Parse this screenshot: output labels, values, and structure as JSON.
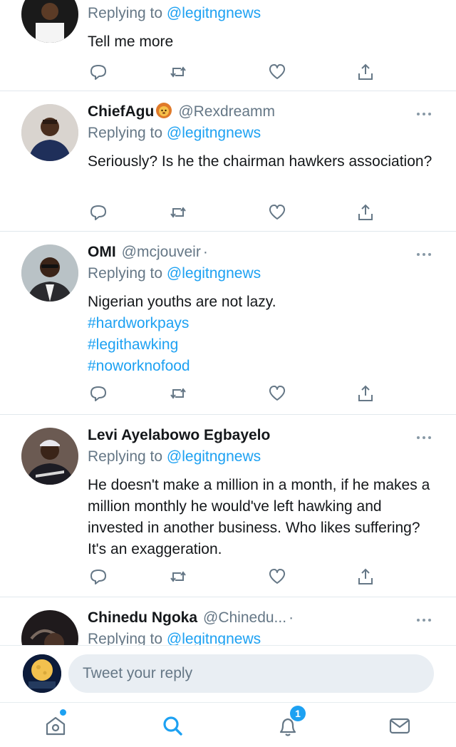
{
  "colors": {
    "accent": "#1da1f2",
    "muted": "#657786",
    "text": "#14171a",
    "divider": "#e1e8ed",
    "input_bg": "#e9eef3"
  },
  "tweets": [
    {
      "reply_prefix": "Replying to",
      "reply_handle": "@legitngnews",
      "text": "Tell me more"
    },
    {
      "name": "ChiefAgu",
      "emoji": "lion-face-icon",
      "handle": "@Rexdreamm",
      "reply_prefix": "Replying to",
      "reply_handle": "@legitngnews",
      "text": "Seriously? Is he the chairman hawkers association?"
    },
    {
      "name": "OMI",
      "handle": "@mcjouveir",
      "separator": "·",
      "reply_prefix": "Replying to",
      "reply_handle": "@legitngnews",
      "text": "Nigerian youths are not lazy.",
      "hashtags": [
        "#hardworkpays",
        "#legithawking",
        "#noworknofood"
      ]
    },
    {
      "name": "Levi Ayelabowo Egbayelo",
      "reply_prefix": "Replying to",
      "reply_handle": "@legitngnews",
      "text": "He doesn't make a million in a month, if he makes a million monthly he would've left hawking and invested in another business. Who likes suffering? It's an exaggeration."
    },
    {
      "name": "Chinedu Ngoka",
      "handle": "@Chinedu...",
      "separator": "·",
      "reply_prefix": "Replying to",
      "reply_handle": "@legitngnews"
    }
  ],
  "actions": [
    "reply-icon",
    "retweet-icon",
    "like-icon",
    "share-icon"
  ],
  "composer": {
    "placeholder": "Tweet your reply"
  },
  "tabbar": {
    "items": [
      "home-icon",
      "search-icon",
      "notifications-icon",
      "messages-icon"
    ],
    "notifications_badge": "1"
  }
}
